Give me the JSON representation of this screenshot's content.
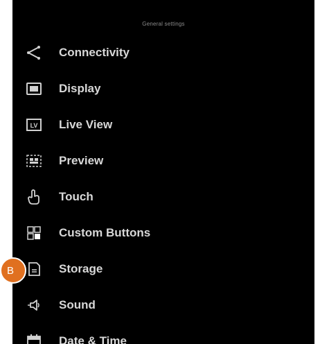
{
  "header": {
    "title": "General settings"
  },
  "menu": {
    "items": [
      {
        "label": "Connectivity",
        "icon": "share-icon"
      },
      {
        "label": "Display",
        "icon": "display-icon"
      },
      {
        "label": "Live View",
        "icon": "live-view-icon"
      },
      {
        "label": "Preview",
        "icon": "preview-icon"
      },
      {
        "label": "Touch",
        "icon": "touch-icon"
      },
      {
        "label": "Custom Buttons",
        "icon": "custom-buttons-icon"
      },
      {
        "label": "Storage",
        "icon": "storage-icon"
      },
      {
        "label": "Sound",
        "icon": "sound-icon"
      },
      {
        "label": "Date & Time",
        "icon": "date-time-icon"
      }
    ]
  },
  "callout": {
    "label": "B"
  },
  "colors": {
    "background": "#000000",
    "text": "#d8d8d8",
    "badge": "#e07020"
  }
}
